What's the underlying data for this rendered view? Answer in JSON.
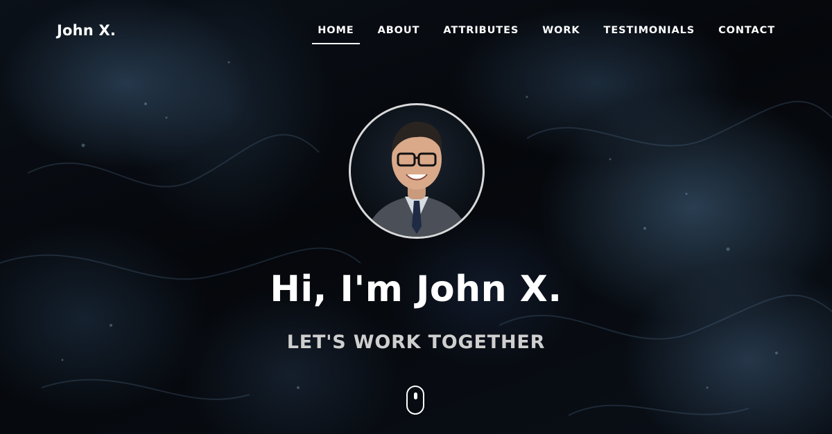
{
  "brand": {
    "name": "John X."
  },
  "nav": {
    "items": [
      {
        "label": "HOME",
        "active": true
      },
      {
        "label": "ABOUT",
        "active": false
      },
      {
        "label": "ATTRIBUTES",
        "active": false
      },
      {
        "label": "WORK",
        "active": false
      },
      {
        "label": "TESTIMONIALS",
        "active": false
      },
      {
        "label": "CONTACT",
        "active": false
      }
    ]
  },
  "hero": {
    "headline": "Hi, I'm John X.",
    "subheadline": "LET'S WORK TOGETHER",
    "avatar_icon": "profile-photo",
    "scroll_icon": "mouse-scroll-icon"
  },
  "colors": {
    "background": "#05070b",
    "text": "#ffffff",
    "subtext": "#cfcfcf",
    "avatar_border": "#d9d9d9"
  }
}
